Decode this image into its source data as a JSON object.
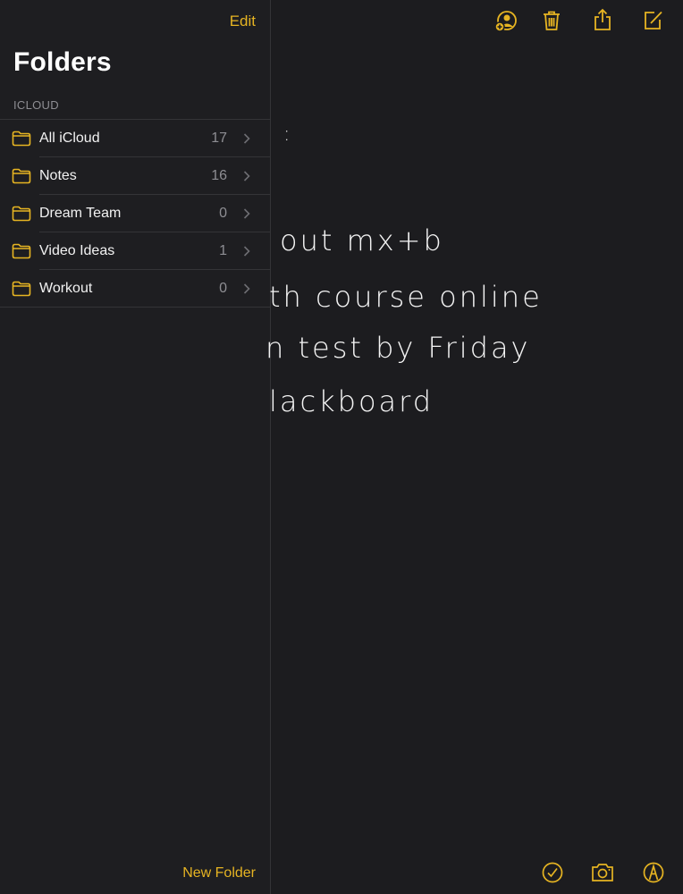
{
  "sidebar": {
    "edit_label": "Edit",
    "title": "Folders",
    "section_header": "ICLOUD",
    "folders": [
      {
        "label": "All iCloud",
        "count": "17"
      },
      {
        "label": "Notes",
        "count": "16"
      },
      {
        "label": "Dream Team",
        "count": "0"
      },
      {
        "label": "Video Ideas",
        "count": "1"
      },
      {
        "label": "Workout",
        "count": "0"
      }
    ],
    "new_folder_label": "New Folder"
  },
  "toolbar": {
    "icons": [
      "add-person-icon",
      "trash-icon",
      "share-icon",
      "compose-icon"
    ]
  },
  "bottom_toolbar": {
    "icons": [
      "checklist-icon",
      "camera-icon",
      "markup-icon"
    ]
  },
  "note": {
    "handwriting_lines": [
      ":",
      "out  mx+b",
      "th  course  online",
      "n  test  by  Friday",
      "lackboard"
    ]
  },
  "colors": {
    "accent": "#e6b422",
    "background": "#1c1c1f"
  }
}
